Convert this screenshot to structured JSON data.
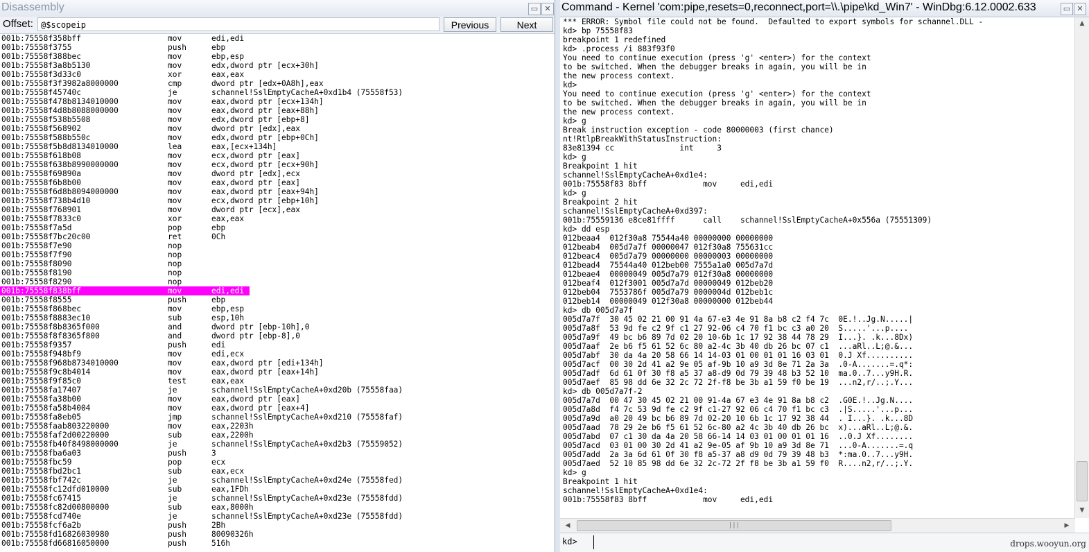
{
  "disasm_window": {
    "title": "Disassembly",
    "offset_label": "Offset:",
    "offset_value": "@$scopeip",
    "previous_button": "Previous",
    "next_button": "Next",
    "highlight_color": "#ff00ff",
    "rows": [
      [
        "001b:75558f35",
        "8bff",
        "mov",
        "edi,edi"
      ],
      [
        "001b:75558f37",
        "55",
        "push",
        "ebp"
      ],
      [
        "001b:75558f38",
        "8bec",
        "mov",
        "ebp,esp"
      ],
      [
        "001b:75558f3a",
        "8b5130",
        "mov",
        "edx,dword ptr [ecx+30h]"
      ],
      [
        "001b:75558f3d",
        "33c0",
        "xor",
        "eax,eax"
      ],
      [
        "001b:75558f3f",
        "3982a8000000",
        "cmp",
        "dword ptr [edx+0A8h],eax"
      ],
      [
        "001b:75558f45",
        "740c",
        "je",
        "schannel!SslEmptyCacheA+0xd1b4 (75558f53)"
      ],
      [
        "001b:75558f47",
        "8b8134010000",
        "mov",
        "eax,dword ptr [ecx+134h]"
      ],
      [
        "001b:75558f4d",
        "8b8088000000",
        "mov",
        "eax,dword ptr [eax+88h]"
      ],
      [
        "001b:75558f53",
        "8b5508",
        "mov",
        "edx,dword ptr [ebp+8]"
      ],
      [
        "001b:75558f56",
        "8902",
        "mov",
        "dword ptr [edx],eax"
      ],
      [
        "001b:75558f58",
        "8b550c",
        "mov",
        "edx,dword ptr [ebp+0Ch]"
      ],
      [
        "001b:75558f5b",
        "8d8134010000",
        "lea",
        "eax,[ecx+134h]"
      ],
      [
        "001b:75558f61",
        "8b08",
        "mov",
        "ecx,dword ptr [eax]"
      ],
      [
        "001b:75558f63",
        "8b8990000000",
        "mov",
        "ecx,dword ptr [ecx+90h]"
      ],
      [
        "001b:75558f69",
        "890a",
        "mov",
        "dword ptr [edx],ecx"
      ],
      [
        "001b:75558f6b",
        "8b00",
        "mov",
        "eax,dword ptr [eax]"
      ],
      [
        "001b:75558f6d",
        "8b8094000000",
        "mov",
        "eax,dword ptr [eax+94h]"
      ],
      [
        "001b:75558f73",
        "8b4d10",
        "mov",
        "ecx,dword ptr [ebp+10h]"
      ],
      [
        "001b:75558f76",
        "8901",
        "mov",
        "dword ptr [ecx],eax"
      ],
      [
        "001b:75558f78",
        "33c0",
        "xor",
        "eax,eax"
      ],
      [
        "001b:75558f7a",
        "5d",
        "pop",
        "ebp"
      ],
      [
        "001b:75558f7b",
        "c20c00",
        "ret",
        "0Ch"
      ],
      [
        "001b:75558f7e",
        "90",
        "nop",
        ""
      ],
      [
        "001b:75558f7f",
        "90",
        "nop",
        ""
      ],
      [
        "001b:75558f80",
        "90",
        "nop",
        ""
      ],
      [
        "001b:75558f81",
        "90",
        "nop",
        ""
      ],
      [
        "001b:75558f82",
        "90",
        "nop",
        ""
      ],
      [
        "001b:75558f83",
        "8bff",
        "mov",
        "edi,edi"
      ],
      [
        "001b:75558f85",
        "55",
        "push",
        "ebp"
      ],
      [
        "001b:75558f86",
        "8bec",
        "mov",
        "ebp,esp"
      ],
      [
        "001b:75558f88",
        "83ec10",
        "sub",
        "esp,10h"
      ],
      [
        "001b:75558f8b",
        "8365f000",
        "and",
        "dword ptr [ebp-10h],0"
      ],
      [
        "001b:75558f8f",
        "8365f800",
        "and",
        "dword ptr [ebp-8],0"
      ],
      [
        "001b:75558f93",
        "57",
        "push",
        "edi"
      ],
      [
        "001b:75558f94",
        "8bf9",
        "mov",
        "edi,ecx"
      ],
      [
        "001b:75558f96",
        "8b8734010000",
        "mov",
        "eax,dword ptr [edi+134h]"
      ],
      [
        "001b:75558f9c",
        "8b4014",
        "mov",
        "eax,dword ptr [eax+14h]"
      ],
      [
        "001b:75558f9f",
        "85c0",
        "test",
        "eax,eax"
      ],
      [
        "001b:75558fa1",
        "7407",
        "je",
        "schannel!SslEmptyCacheA+0xd20b (75558faa)"
      ],
      [
        "001b:75558fa3",
        "8b00",
        "mov",
        "eax,dword ptr [eax]"
      ],
      [
        "001b:75558fa5",
        "8b4004",
        "mov",
        "eax,dword ptr [eax+4]"
      ],
      [
        "001b:75558fa8",
        "eb05",
        "jmp",
        "schannel!SslEmptyCacheA+0xd210 (75558faf)"
      ],
      [
        "001b:75558faa",
        "b803220000",
        "mov",
        "eax,2203h"
      ],
      [
        "001b:75558faf",
        "2d00220000",
        "sub",
        "eax,2200h"
      ],
      [
        "001b:75558fb4",
        "0f8498000000",
        "je",
        "schannel!SslEmptyCacheA+0xd2b3 (75559052)"
      ],
      [
        "001b:75558fba",
        "6a03",
        "push",
        "3"
      ],
      [
        "001b:75558fbc",
        "59",
        "pop",
        "ecx"
      ],
      [
        "001b:75558fbd",
        "2bc1",
        "sub",
        "eax,ecx"
      ],
      [
        "001b:75558fbf",
        "742c",
        "je",
        "schannel!SslEmptyCacheA+0xd24e (75558fed)"
      ],
      [
        "001b:75558fc1",
        "2dfd010000",
        "sub",
        "eax,1FDh"
      ],
      [
        "001b:75558fc6",
        "7415",
        "je",
        "schannel!SslEmptyCacheA+0xd23e (75558fdd)"
      ],
      [
        "001b:75558fc8",
        "2d00800000",
        "sub",
        "eax,8000h"
      ],
      [
        "001b:75558fcd",
        "740e",
        "je",
        "schannel!SslEmptyCacheA+0xd23e (75558fdd)"
      ],
      [
        "001b:75558fcf",
        "6a2b",
        "push",
        "2Bh"
      ],
      [
        "001b:75558fd1",
        "6826030980",
        "push",
        "80090326h"
      ],
      [
        "001b:75558fd6",
        "6816050000",
        "push",
        "516h"
      ]
    ],
    "highlight_row": 28
  },
  "command_window": {
    "title": "Command - Kernel 'com:pipe,resets=0,reconnect,port=\\\\.\\pipe\\kd_Win7' - WinDbg:6.12.0002.633",
    "prompt_label": "kd>",
    "prompt_value": "",
    "watermark": "drops.wooyun.org",
    "lines": [
      "*** ERROR: Symbol file could not be found.  Defaulted to export symbols for schannel.DLL -",
      "kd> bp 75558f83",
      "breakpoint 1 redefined",
      "kd> .process /i 883f93f0",
      "You need to continue execution (press 'g' <enter>) for the context",
      "to be switched. When the debugger breaks in again, you will be in",
      "the new process context.",
      "kd>",
      "You need to continue execution (press 'g' <enter>) for the context",
      "to be switched. When the debugger breaks in again, you will be in",
      "the new process context.",
      "kd> g",
      "Break instruction exception - code 80000003 (first chance)",
      "nt!RtlpBreakWithStatusInstruction:",
      "83e81394 cc              int     3",
      "kd> g",
      "Breakpoint 1 hit",
      "schannel!SslEmptyCacheA+0xd1e4:",
      "001b:75558f83 8bff            mov     edi,edi",
      "kd> g",
      "Breakpoint 2 hit",
      "schannel!SslEmptyCacheA+0xd397:",
      "001b:75559136 e8ce81ffff      call    schannel!SslEmptyCacheA+0x556a (75551309)",
      "kd> dd esp",
      "012beaa4  012f30a8 75544a40 00000000 00000000",
      "012beab4  005d7a7f 00000047 012f30a8 755631cc",
      "012beac4  005d7a79 00000000 00000003 00000000",
      "012bead4  75544a40 012beb00 7555a1a0 005d7a7d",
      "012beae4  00000049 005d7a79 012f30a8 00000000",
      "012beaf4  012f3001 005d7a7d 00000049 012beb20",
      "012beb04  7553786f 005d7a79 0000004d 012beb1c",
      "012beb14  00000049 012f30a8 00000000 012beb44",
      "kd> db 005d7a7f",
      "005d7a7f  30 45 02 21 00 91 4a 67-e3 4e 91 8a b8 c2 f4 7c  0E.!..Jg.N.....|",
      "005d7a8f  53 9d fe c2 9f c1 27 92-06 c4 70 f1 bc c3 a0 20  S.....'...p....",
      "005d7a9f  49 bc b6 89 7d 02 20 10-6b 1c 17 92 38 44 78 29  I...}. .k...8Dx)",
      "005d7aaf  2e b6 f5 61 52 6c 80 a2-4c 3b 40 db 26 bc 07 c1  ...aRl..L;@.&...",
      "005d7abf  30 da 4a 20 58 66 14 14-03 01 00 01 01 16 03 01  0.J Xf..........",
      "005d7acf  00 30 2d 41 a2 9e 05 af-9b 10 a9 3d 8e 71 2a 3a  .0-A.......=.q*:",
      "005d7adf  6d 61 0f 30 f8 a5 37 a8-d9 0d 79 39 48 b3 52 10  ma.0..7...y9H.R.",
      "005d7aef  85 98 dd 6e 32 2c 72 2f-f8 be 3b a1 59 f0 be 19  ...n2,r/..;.Y...",
      "kd> db 005d7a7f-2",
      "005d7a7d  00 47 30 45 02 21 00 91-4a 67 e3 4e 91 8a b8 c2  .G0E.!..Jg.N....",
      "005d7a8d  f4 7c 53 9d fe c2 9f c1-27 92 06 c4 70 f1 bc c3  .|S.....'...p...",
      "005d7a9d  a0 20 49 bc b6 89 7d 02-20 10 6b 1c 17 92 38 44  . I...}. .k...8D",
      "005d7aad  78 29 2e b6 f5 61 52 6c-80 a2 4c 3b 40 db 26 bc  x)...aRl..L;@.&.",
      "005d7abd  07 c1 30 da 4a 20 58 66-14 14 03 01 00 01 01 16  ..0.J Xf........",
      "005d7acd  03 01 00 30 2d 41 a2 9e-05 af 9b 10 a9 3d 8e 71  ...0-A.......=.q",
      "005d7add  2a 3a 6d 61 0f 30 f8 a5-37 a8 d9 0d 79 39 48 b3  *:ma.0..7...y9H.",
      "005d7aed  52 10 85 98 dd 6e 32 2c-72 2f f8 be 3b a1 59 f0  R....n2,r/..;.Y.",
      "kd> g",
      "Breakpoint 1 hit",
      "schannel!SslEmptyCacheA+0xd1e4:",
      "001b:75558f83 8bff            mov     edi,edi"
    ]
  }
}
